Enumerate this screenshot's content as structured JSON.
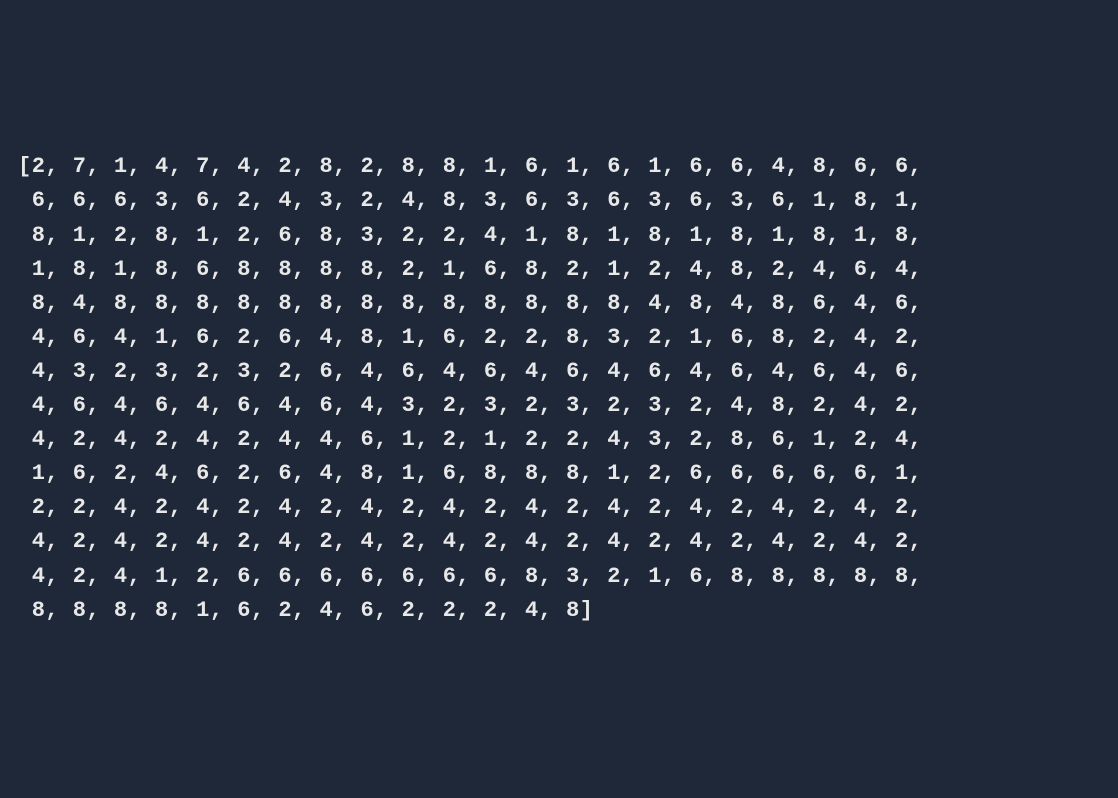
{
  "array_values": [
    2,
    7,
    1,
    4,
    7,
    4,
    2,
    8,
    2,
    8,
    8,
    1,
    6,
    1,
    6,
    1,
    6,
    6,
    4,
    8,
    6,
    6,
    6,
    6,
    6,
    3,
    6,
    2,
    4,
    3,
    2,
    4,
    8,
    3,
    6,
    3,
    6,
    3,
    6,
    3,
    6,
    1,
    8,
    1,
    8,
    1,
    2,
    8,
    1,
    2,
    6,
    8,
    3,
    2,
    2,
    4,
    1,
    8,
    1,
    8,
    1,
    8,
    1,
    8,
    1,
    8,
    1,
    8,
    1,
    8,
    6,
    8,
    8,
    8,
    8,
    2,
    1,
    6,
    8,
    2,
    1,
    2,
    4,
    8,
    2,
    4,
    6,
    4,
    8,
    4,
    8,
    8,
    8,
    8,
    8,
    8,
    8,
    8,
    8,
    8,
    8,
    8,
    8,
    4,
    8,
    4,
    8,
    6,
    4,
    6,
    4,
    6,
    4,
    1,
    6,
    2,
    6,
    4,
    8,
    1,
    6,
    2,
    2,
    8,
    3,
    2,
    1,
    6,
    8,
    2,
    4,
    2,
    4,
    3,
    2,
    3,
    2,
    3,
    2,
    6,
    4,
    6,
    4,
    6,
    4,
    6,
    4,
    6,
    4,
    6,
    4,
    6,
    4,
    6,
    4,
    6,
    4,
    6,
    4,
    6,
    4,
    6,
    4,
    3,
    2,
    3,
    2,
    3,
    2,
    3,
    2,
    4,
    8,
    2,
    4,
    2,
    4,
    2,
    4,
    2,
    4,
    2,
    4,
    4,
    6,
    1,
    2,
    1,
    2,
    2,
    4,
    3,
    2,
    8,
    6,
    1,
    2,
    4,
    1,
    6,
    2,
    4,
    6,
    2,
    6,
    4,
    8,
    1,
    6,
    8,
    8,
    8,
    1,
    2,
    6,
    6,
    6,
    6,
    6,
    1,
    2,
    2,
    4,
    2,
    4,
    2,
    4,
    2,
    4,
    2,
    4,
    2,
    4,
    2,
    4,
    2,
    4,
    2,
    4,
    2,
    4,
    2,
    4,
    2,
    4,
    2,
    4,
    2,
    4,
    2,
    4,
    2,
    4,
    2,
    4,
    2,
    4,
    2,
    4,
    2,
    4,
    2,
    4,
    2,
    4,
    2,
    4,
    1,
    2,
    6,
    6,
    6,
    6,
    6,
    6,
    6,
    8,
    3,
    2,
    1,
    6,
    8,
    8,
    8,
    8,
    8,
    8,
    8,
    8,
    8,
    1,
    6,
    2,
    4,
    6,
    2,
    2,
    2,
    4,
    8
  ],
  "items_per_line": 22,
  "lines": [
    "[2, 7, 1, 4, 7, 4, 2, 8, 2, 8, 8, 1, 6, 1, 6, 1, 6, 6, 4, 8, 6, 6,",
    " 6, 6, 6, 3, 6, 2, 4, 3, 2, 4, 8, 3, 6, 3, 6, 3, 6, 3, 6, 1, 8, 1,",
    " 8, 1, 2, 8, 1, 2, 6, 8, 3, 2, 2, 4, 1, 8, 1, 8, 1, 8, 1, 8, 1, 8,",
    " 1, 8, 1, 8, 6, 8, 8, 8, 8, 2, 1, 6, 8, 2, 1, 2, 4, 8, 2, 4, 6, 4,",
    " 8, 4, 8, 8, 8, 8, 8, 8, 8, 8, 8, 8, 8, 8, 8, 4, 8, 4, 8, 6, 4, 6,",
    " 4, 6, 4, 1, 6, 2, 6, 4, 8, 1, 6, 2, 2, 8, 3, 2, 1, 6, 8, 2, 4, 2,",
    " 4, 3, 2, 3, 2, 3, 2, 6, 4, 6, 4, 6, 4, 6, 4, 6, 4, 6, 4, 6, 4, 6,",
    " 4, 6, 4, 6, 4, 6, 4, 6, 4, 3, 2, 3, 2, 3, 2, 3, 2, 4, 8, 2, 4, 2,",
    " 4, 2, 4, 2, 4, 2, 4, 4, 6, 1, 2, 1, 2, 2, 4, 3, 2, 8, 6, 1, 2, 4,",
    " 1, 6, 2, 4, 6, 2, 6, 4, 8, 1, 6, 8, 8, 8, 1, 2, 6, 6, 6, 6, 6, 1,",
    " 2, 2, 4, 2, 4, 2, 4, 2, 4, 2, 4, 2, 4, 2, 4, 2, 4, 2, 4, 2, 4, 2,",
    " 4, 2, 4, 2, 4, 2, 4, 2, 4, 2, 4, 2, 4, 2, 4, 2, 4, 2, 4, 2, 4, 2,",
    " 4, 2, 4, 1, 2, 6, 6, 6, 6, 6, 6, 6, 8, 3, 2, 1, 6, 8, 8, 8, 8, 8,",
    " 8, 8, 8, 8, 1, 6, 2, 4, 6, 2, 2, 2, 4, 8]"
  ]
}
